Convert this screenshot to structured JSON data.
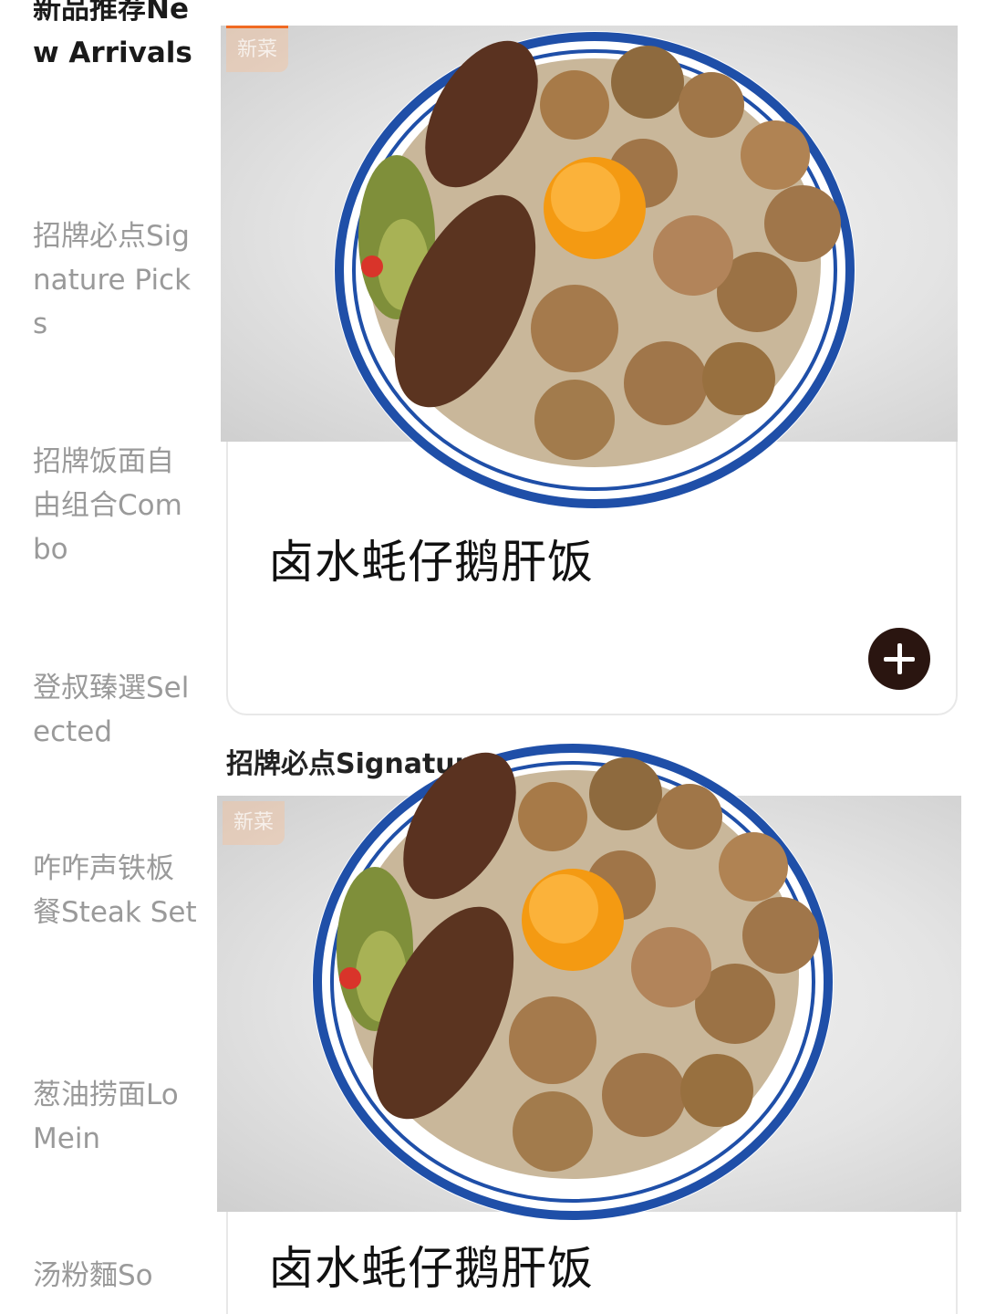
{
  "sidebar": {
    "items": [
      {
        "label": "新品推荐New Arrivals",
        "active": true
      },
      {
        "label": "招牌必点Signature Picks",
        "active": false
      },
      {
        "label": "招牌饭面自由组合Combo",
        "active": false
      },
      {
        "label": "登叔臻選Selected",
        "active": false
      },
      {
        "label": "咋咋声铁板餐Steak Set",
        "active": false
      },
      {
        "label": "葱油捞面Lo Mein",
        "active": false
      },
      {
        "label": "汤粉麵So",
        "active": false
      }
    ]
  },
  "products": [
    {
      "name": "卤水蚝仔鹅肝饭",
      "badge": "新菜",
      "image": "rice-bowl-with-foie-gras-oysters-egg-yolk"
    },
    {
      "name": "卤水蚝仔鹅肝饭",
      "badge": "新菜",
      "image": "rice-bowl-with-foie-gras-oysters-egg-yolk"
    }
  ],
  "section": {
    "title": "招牌必点Signature Picks"
  },
  "icons": {
    "add": "plus-icon"
  },
  "colors": {
    "accent": "#2a1510",
    "badge": "#f06a22",
    "plate_rim": "#1f4fa8"
  }
}
